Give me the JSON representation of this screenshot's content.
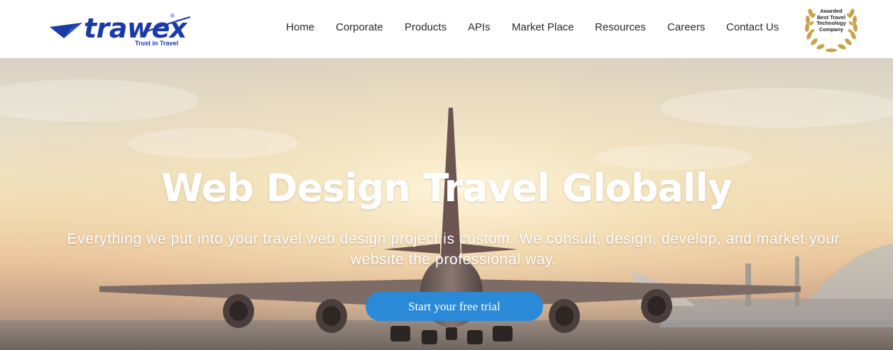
{
  "brand": {
    "name": "trawex",
    "tagline": "Trust in Travel",
    "registered": "®",
    "color": "#1a3aa8"
  },
  "nav": {
    "items": [
      {
        "label": "Home"
      },
      {
        "label": "Corporate"
      },
      {
        "label": "Products"
      },
      {
        "label": "APIs"
      },
      {
        "label": "Market Place"
      },
      {
        "label": "Resources"
      },
      {
        "label": "Careers"
      },
      {
        "label": "Contact Us"
      }
    ]
  },
  "award": {
    "line1": "Awarded",
    "line2": "Best Travel",
    "line3": "Technology",
    "line4": "Company",
    "icon": "laurel-wreath-icon"
  },
  "hero": {
    "title": "Web Design Travel Globally",
    "subtitle": "Everything we put into your travel web design project is custom. We consult, design, develop, and market your website the professional way.",
    "cta_label": "Start your free trial",
    "cta_color": "#2a8ad8"
  }
}
